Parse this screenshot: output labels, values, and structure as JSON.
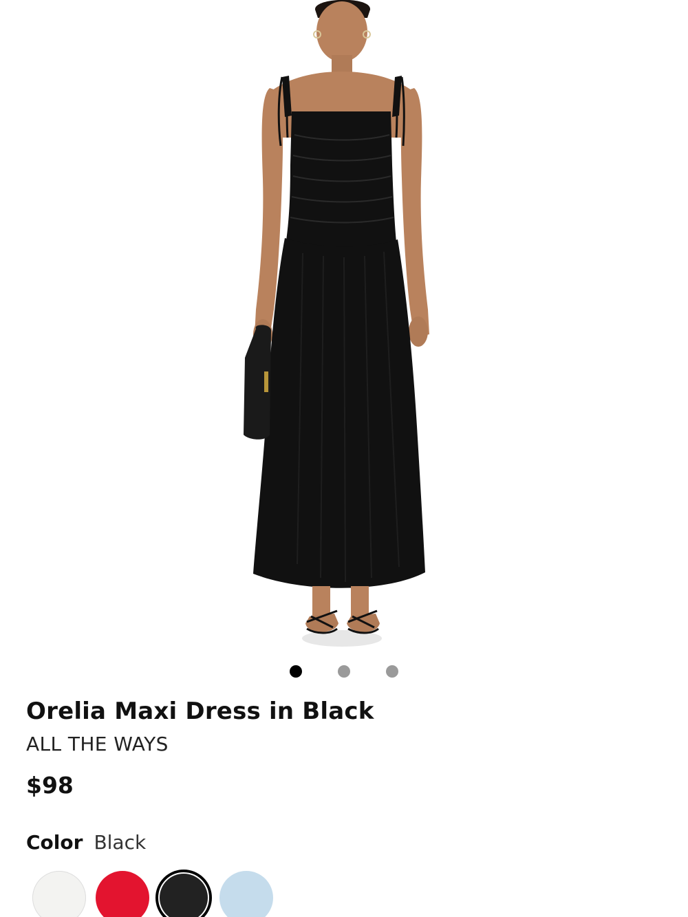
{
  "product": {
    "title": "Orelia Maxi Dress in Black",
    "brand": "ALL THE WAYS",
    "price": "$98"
  },
  "gallery": {
    "image_subject": "model-wearing-black-maxi-dress",
    "total_slides": 3,
    "active_slide": 1
  },
  "color": {
    "label": "Color",
    "selected": "Black",
    "swatches": [
      {
        "name": "white",
        "hex": "#f3f3f1"
      },
      {
        "name": "red",
        "hex": "#e3142f"
      },
      {
        "name": "black",
        "hex": "#222222",
        "selected": true
      },
      {
        "name": "light-blue",
        "hex": "#c5dcec"
      }
    ]
  },
  "colors": {
    "dress": "#111111",
    "skin": "#b9825d",
    "dot_active": "#000000",
    "dot_inactive": "#9a9a9a"
  }
}
